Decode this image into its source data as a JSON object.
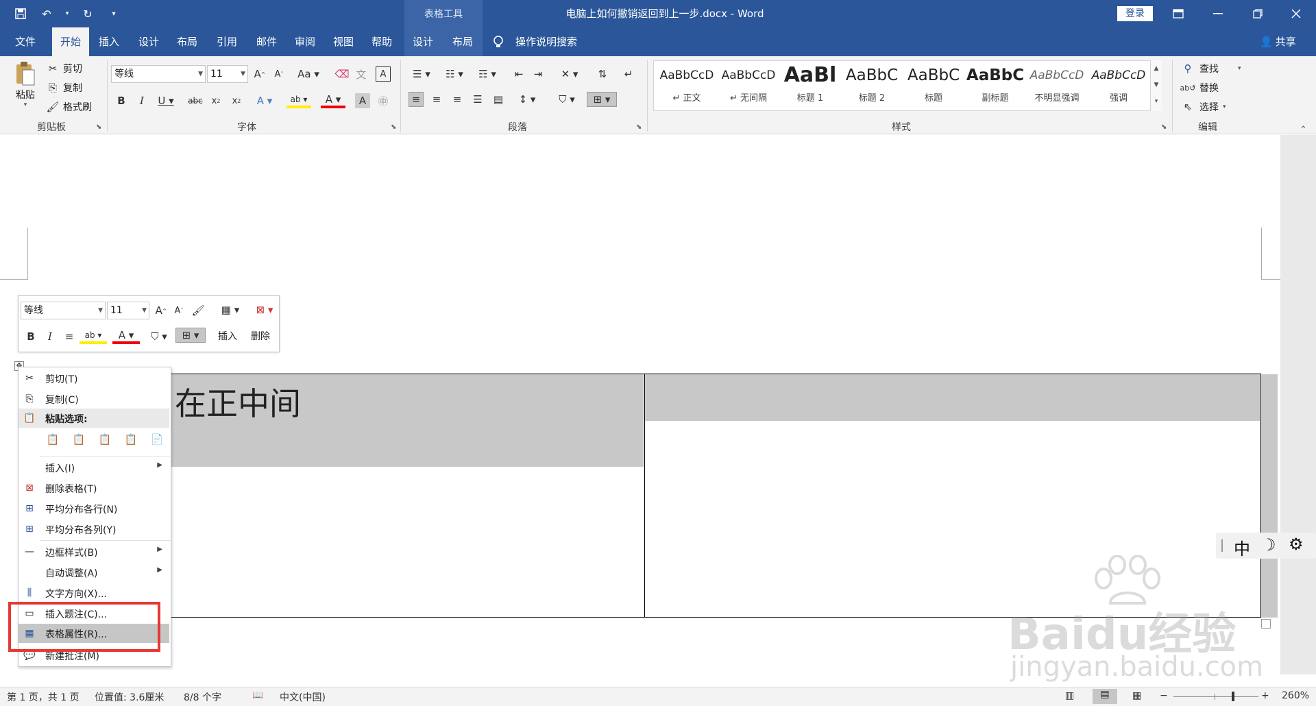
{
  "titlebar": {
    "contextual_group": "表格工具",
    "doc_title": "电脑上如何撤销返回到上一步.docx  -  Word",
    "login": "登录"
  },
  "tabs": [
    "文件",
    "开始",
    "插入",
    "设计",
    "布局",
    "引用",
    "邮件",
    "审阅",
    "视图",
    "帮助",
    "设计",
    "布局"
  ],
  "tell_me": "操作说明搜索",
  "share": "共享",
  "clipboard": {
    "paste": "粘贴",
    "cut": "剪切",
    "copy": "复制",
    "format_painter": "格式刷",
    "label": "剪贴板"
  },
  "font": {
    "name": "等线",
    "size": "11",
    "label": "字体"
  },
  "paragraph": {
    "label": "段落"
  },
  "styles": {
    "label": "样式",
    "items": [
      {
        "sample": "AaBbCcD",
        "name": "↵ 正文"
      },
      {
        "sample": "AaBbCcD",
        "name": "↵ 无间隔"
      },
      {
        "sample": "AaBl",
        "name": "标题 1"
      },
      {
        "sample": "AaBbC",
        "name": "标题 2"
      },
      {
        "sample": "AaBbC",
        "name": "标题"
      },
      {
        "sample": "AaBbC",
        "name": "副标题"
      },
      {
        "sample": "AaBbCcD",
        "name": "不明显强调"
      },
      {
        "sample": "AaBbCcD",
        "name": "强调"
      }
    ]
  },
  "editing": {
    "find": "查找",
    "replace": "替换",
    "select": "选择",
    "label": "编辑"
  },
  "mini_toolbar": {
    "font": "等线",
    "size": "11",
    "insert": "插入",
    "delete": "删除"
  },
  "table": {
    "cell_text": "在正中间"
  },
  "context_menu": {
    "cut": "剪切(T)",
    "copy": "复制(C)",
    "paste_options": "粘贴选项:",
    "insert": "插入(I)",
    "delete_table": "删除表格(T)",
    "distribute_rows": "平均分布各行(N)",
    "distribute_cols": "平均分布各列(Y)",
    "border_styles": "边框样式(B)",
    "autofit": "自动调整(A)",
    "text_direction": "文字方向(X)...",
    "insert_caption": "插入题注(C)...",
    "table_properties": "表格属性(R)...",
    "new_comment": "新建批注(M)"
  },
  "ime": {
    "mode": "中"
  },
  "watermark": {
    "line1": "Baidu经验",
    "line2": "jingyan.baidu.com"
  },
  "status": {
    "page": "第 1 页，共 1 页",
    "position": "位置值: 3.6厘米",
    "words": "8/8 个字",
    "language": "中文(中国)",
    "zoom": "260%"
  }
}
